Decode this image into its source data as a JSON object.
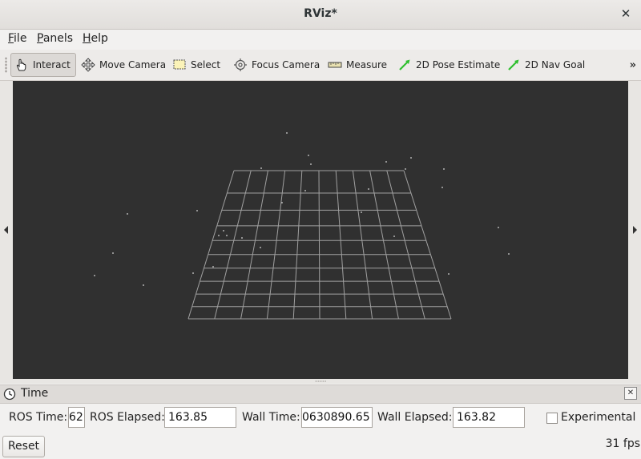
{
  "window": {
    "title": "RViz*",
    "close_glyph": "✕"
  },
  "menu": [
    {
      "key": "F",
      "rest": "ile"
    },
    {
      "key": "P",
      "rest": "anels"
    },
    {
      "key": "H",
      "rest": "elp"
    }
  ],
  "toolbar": {
    "tools": [
      {
        "label": "Interact",
        "icon": "hand-icon",
        "active": true
      },
      {
        "label": "Move Camera",
        "icon": "move-camera-icon",
        "active": false
      },
      {
        "label": "Select",
        "icon": "select-icon",
        "active": false
      },
      {
        "label": "Focus Camera",
        "icon": "focus-camera-icon",
        "active": false
      },
      {
        "label": "Measure",
        "icon": "ruler-icon",
        "active": false
      },
      {
        "label": "2D Pose Estimate",
        "icon": "green-arrow-icon",
        "active": false
      },
      {
        "label": "2D Nav Goal",
        "icon": "green-arrow-icon",
        "active": false
      }
    ],
    "more_glyph": "»"
  },
  "viewport": {
    "background": "#303030",
    "grid_color": "#a0a0a0"
  },
  "time_panel": {
    "title": "Time",
    "close_glyph": "✕",
    "ros_time_label": "ROS Time:",
    "ros_time_value": "62",
    "ros_elapsed_label": "ROS Elapsed:",
    "ros_elapsed_value": "163.85",
    "wall_time_label": "Wall Time:",
    "wall_time_value": "0630890.65",
    "wall_elapsed_label": "Wall Elapsed:",
    "wall_elapsed_value": "163.82",
    "experimental_label": "Experimental",
    "experimental_checked": false
  },
  "footer": {
    "reset_label": "Reset",
    "fps": "31 fps"
  },
  "colors": {
    "accent_green": "#2fbf2f",
    "window_bg": "#f2f1f0"
  }
}
